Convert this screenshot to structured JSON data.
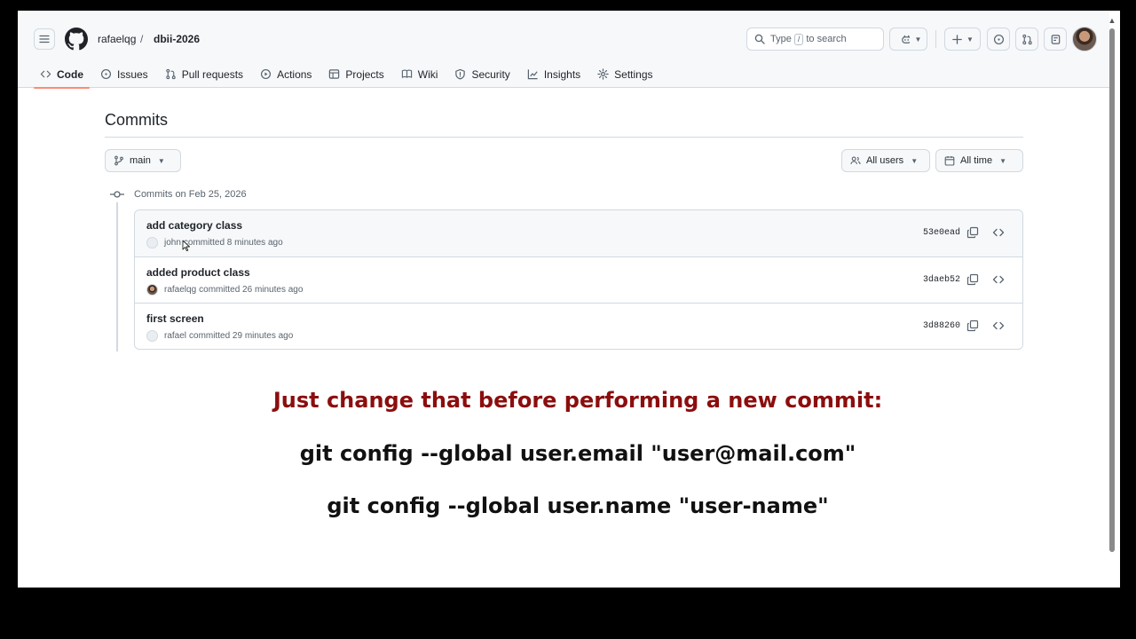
{
  "header": {
    "owner": "rafaelqg",
    "separator": "/",
    "repo": "dbii-2026",
    "search_prefix": "Type",
    "search_key": "/",
    "search_suffix": "to search"
  },
  "tabs": [
    {
      "label": "Code",
      "icon": "code-icon",
      "active": true
    },
    {
      "label": "Issues",
      "icon": "issue-icon"
    },
    {
      "label": "Pull requests",
      "icon": "pull-request-icon"
    },
    {
      "label": "Actions",
      "icon": "play-icon"
    },
    {
      "label": "Projects",
      "icon": "table-icon"
    },
    {
      "label": "Wiki",
      "icon": "book-icon"
    },
    {
      "label": "Security",
      "icon": "shield-icon"
    },
    {
      "label": "Insights",
      "icon": "graph-icon"
    },
    {
      "label": "Settings",
      "icon": "gear-icon"
    }
  ],
  "page": {
    "title": "Commits",
    "branch": "main",
    "users_filter": "All users",
    "time_filter": "All time",
    "group_label": "Commits on Feb 25, 2026"
  },
  "commits": [
    {
      "message": "add category class",
      "author": "john",
      "time": "committed 8 minutes ago",
      "sha": "53e0ead"
    },
    {
      "message": "added product class",
      "author": "rafaelqg",
      "time": "committed 26 minutes ago",
      "sha": "3daeb52"
    },
    {
      "message": "first screen",
      "author": "rafael",
      "time": "committed 29 minutes ago",
      "sha": "3d88260"
    }
  ],
  "overlay": {
    "heading": "Just change that before performing a new commit:",
    "command1": "git config --global user.email \"user@mail.com\"",
    "command2": "git config --global user.name \"user-name\""
  },
  "colors": {
    "accent_underline": "#fd8c73",
    "overlay_heading": "#8b0e0e"
  }
}
